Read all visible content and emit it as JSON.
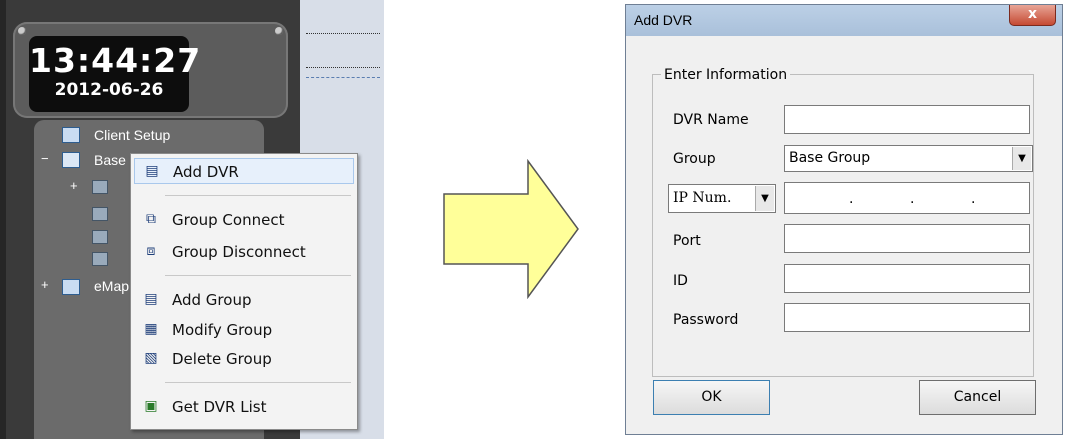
{
  "clock": {
    "time": "13:44:27",
    "date": "2012-06-26"
  },
  "tree": {
    "client_setup": "Client Setup",
    "base_group": "Base",
    "emap": "eMap",
    "expanders": {
      "minus": "−",
      "plus": "+"
    }
  },
  "context_menu": {
    "items": [
      {
        "label": "Add DVR",
        "icon": "add-dvr-icon",
        "glyph": "▤"
      },
      {
        "label": "Group Connect",
        "icon": "group-connect-icon",
        "glyph": "⧉"
      },
      {
        "label": "Group Disconnect",
        "icon": "group-disconnect-icon",
        "glyph": "⧈"
      },
      {
        "label": "Add Group",
        "icon": "add-group-icon",
        "glyph": "▤"
      },
      {
        "label": "Modify Group",
        "icon": "modify-group-icon",
        "glyph": "▦"
      },
      {
        "label": "Delete Group",
        "icon": "delete-group-icon",
        "glyph": "▧"
      },
      {
        "label": "Get DVR List",
        "icon": "get-dvr-list-icon",
        "glyph": "▣"
      }
    ]
  },
  "dialog": {
    "title": "Add DVR",
    "close_glyph": "x",
    "groupbox_label": "Enter Information",
    "labels": {
      "dvr_name": "DVR Name",
      "group": "Group",
      "port": "Port",
      "id": "ID",
      "password": "Password"
    },
    "group_value": "Base Group",
    "ip_mode_value": "IP Num.",
    "ip_separator": ".",
    "ok_label": "OK",
    "cancel_label": "Cancel",
    "dropdown_glyph": "▼"
  },
  "colors": {
    "arrow_fill": "#ffff99",
    "arrow_stroke": "#555555"
  }
}
